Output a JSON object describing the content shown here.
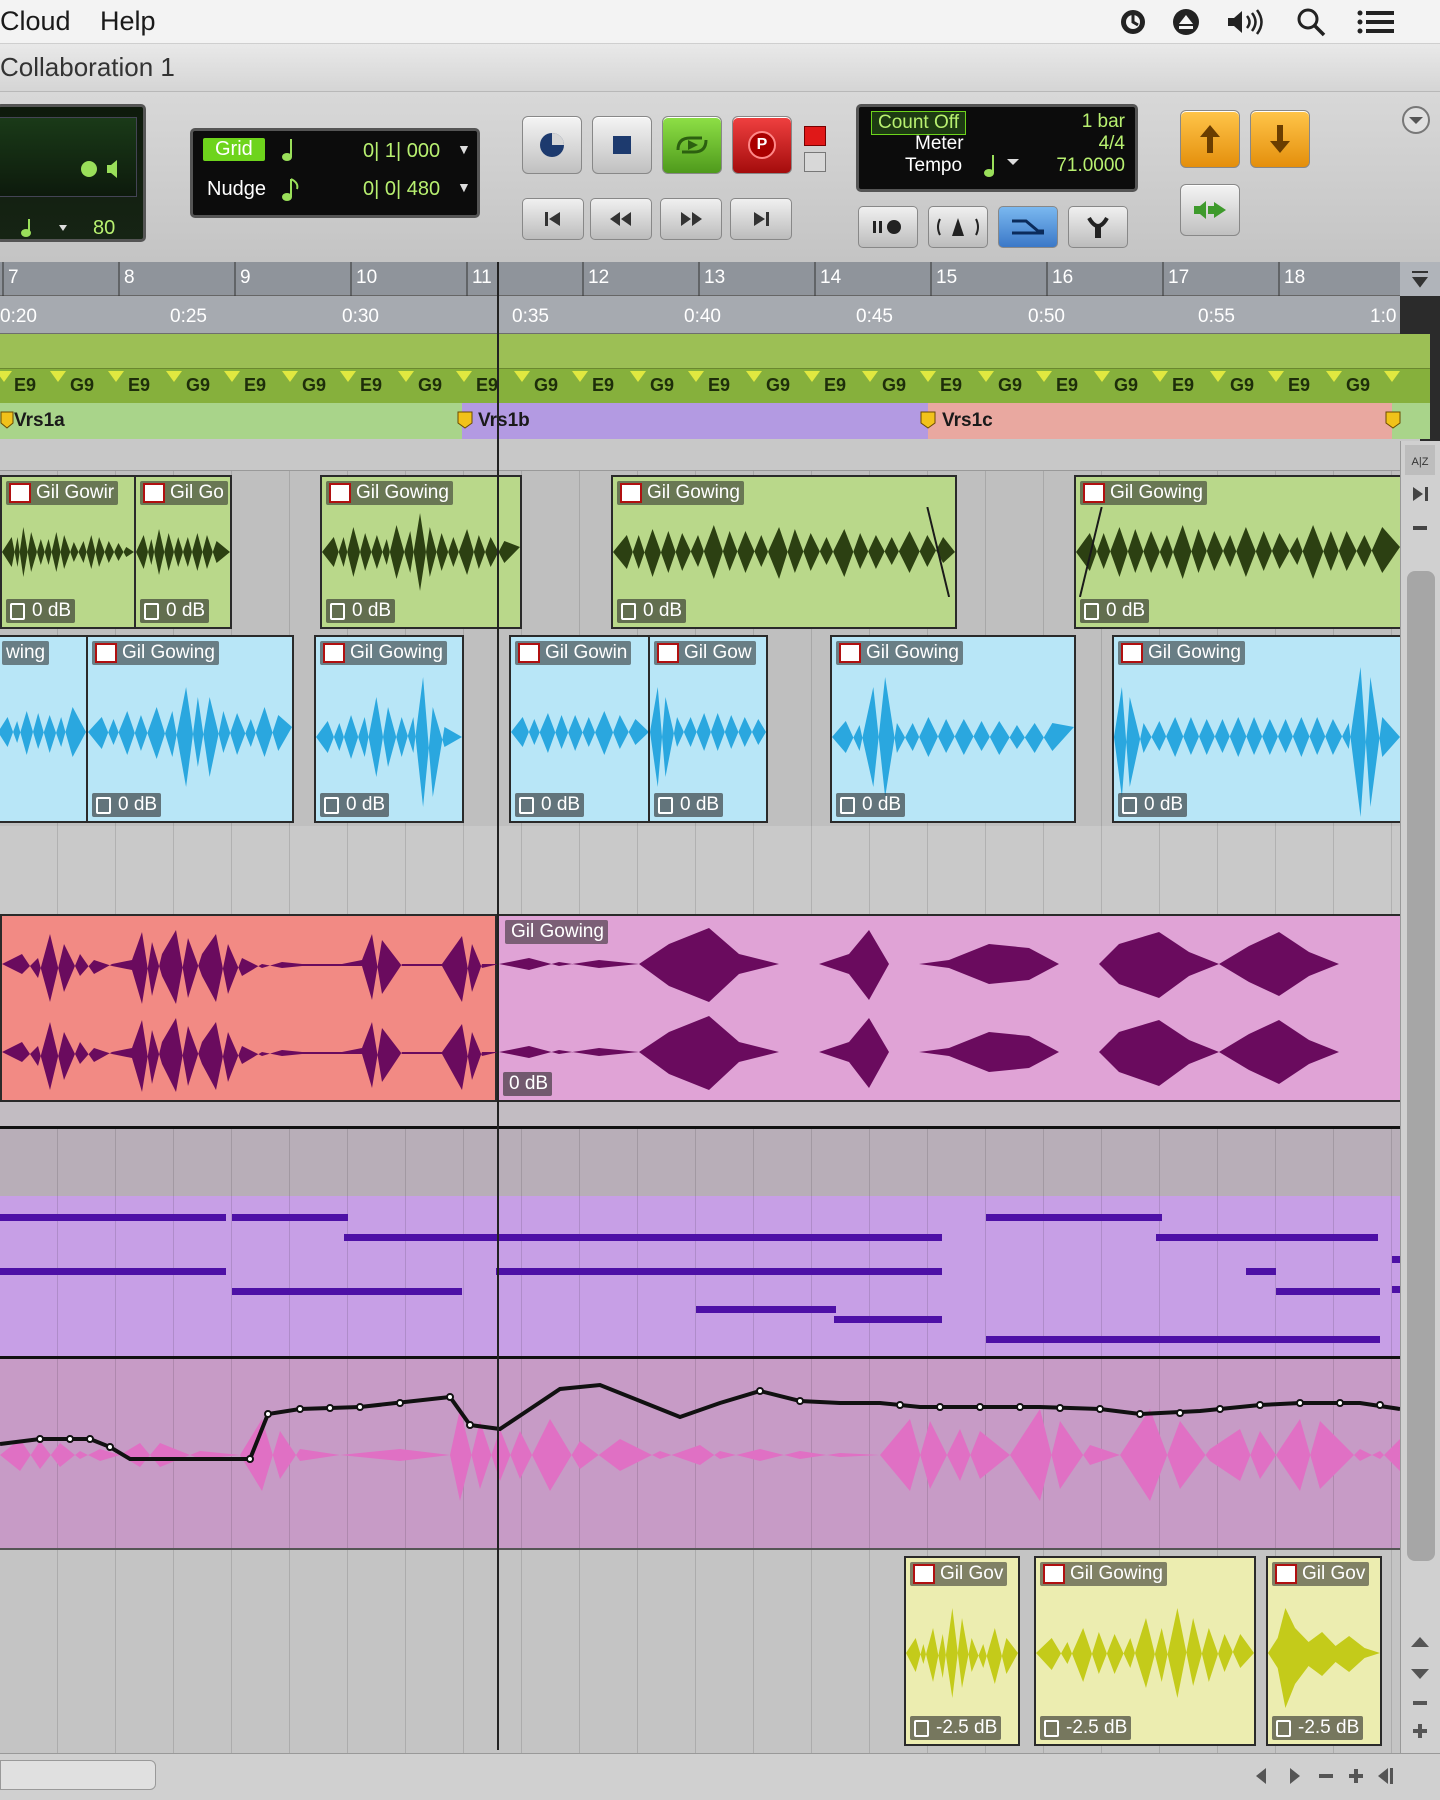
{
  "menubar": {
    "items": [
      "Cloud",
      "Help"
    ]
  },
  "window": {
    "title": "Collaboration 1"
  },
  "toolbar": {
    "edit_lcd_value": "80",
    "grid_label": "Grid",
    "grid_value": "0| 1| 000",
    "nudge_label": "Nudge",
    "nudge_value": "0| 0| 480",
    "count_off": "Count Off",
    "count_off_value": "1 bar",
    "meter_label": "Meter",
    "meter_value": "4/4",
    "tempo_label": "Tempo",
    "tempo_value": "71.0000",
    "record_glyph": "P"
  },
  "bars_ruler": [
    "7",
    "8",
    "9",
    "10",
    "11",
    "12",
    "13",
    "14",
    "15",
    "16",
    "17",
    "18"
  ],
  "time_ruler": [
    "0:20",
    "0:25",
    "0:30",
    "0:35",
    "0:40",
    "0:45",
    "0:50",
    "0:55",
    "1:0"
  ],
  "chords": [
    "E9",
    "G9",
    "E9",
    "G9",
    "E9",
    "G9",
    "E9",
    "G9",
    "E9",
    "G9",
    "E9",
    "G9",
    "E9",
    "G9",
    "E9",
    "G9",
    "E9",
    "G9",
    "E9",
    "G9",
    "E9",
    "G9",
    "E9",
    "G9"
  ],
  "markers": [
    "Vrs1a",
    "Vrs1b",
    "Vrs1c"
  ],
  "track1": {
    "clips": [
      {
        "name": "Gil Gowir",
        "gain": "0 dB"
      },
      {
        "name": "Gil Go",
        "gain": "0 dB"
      },
      {
        "name": "Gil Gowing",
        "gain": "0 dB"
      },
      {
        "name": "Gil Gowing",
        "gain": "0 dB"
      },
      {
        "name": "Gil Gowing",
        "gain": "0 dB"
      }
    ]
  },
  "track2": {
    "clips": [
      {
        "name": "wing",
        "gain": ""
      },
      {
        "name": "Gil Gowing",
        "gain": "0 dB"
      },
      {
        "name": "Gil Gowing",
        "gain": "0 dB"
      },
      {
        "name": "Gil Gowin",
        "gain": "0 dB"
      },
      {
        "name": "Gil Gow",
        "gain": "0 dB"
      },
      {
        "name": "Gil Gowing",
        "gain": "0 dB"
      },
      {
        "name": "Gil Gowing",
        "gain": "0 dB"
      }
    ]
  },
  "track3": {
    "clip_name": "Gil Gowing",
    "gain": "0 dB"
  },
  "track6": {
    "clips": [
      {
        "name": "Gil Gov",
        "gain": "-2.5 dB"
      },
      {
        "name": "Gil Gowing",
        "gain": "-2.5 dB"
      },
      {
        "name": "Gil Gov",
        "gain": "-2.5 dB"
      }
    ]
  },
  "colors": {
    "track1_clip": "#b9d88a",
    "track1_wave": "#2c4012",
    "track2_clip": "#b8e6f7",
    "track2_wave": "#2aa7df",
    "track3_left": "#f28a84",
    "track3_right": "#e0a3d6",
    "track3_wave": "#6a0b5e",
    "midi_bg": "#c79fe6",
    "midi_note": "#4d10a6",
    "track5_bg": "#c79bc6",
    "track5_wave": "#e070c4",
    "track6_clip": "#ecedb0",
    "track6_wave": "#c4cb1a",
    "record": "#d01818",
    "play": "#6cbd2a",
    "nav_up": "#f0a81c"
  }
}
